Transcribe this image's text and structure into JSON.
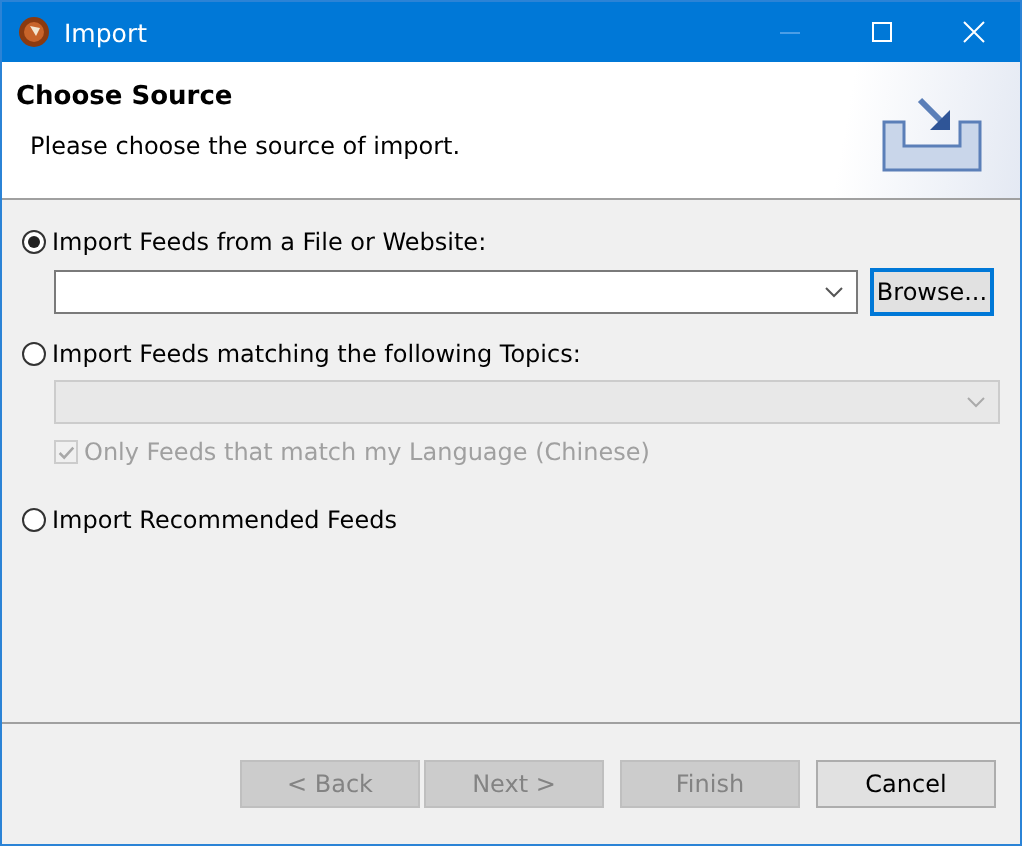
{
  "window": {
    "title": "Import"
  },
  "header": {
    "title": "Choose Source",
    "description": "Please choose the source of import."
  },
  "options": [
    {
      "kind": "file",
      "label": "Import Feeds from a File or Website:",
      "selected": true,
      "field": {
        "disabled": false
      },
      "button": "Browse..."
    },
    {
      "kind": "topics",
      "label": "Import Feeds matching the following Topics:",
      "selected": false,
      "field": {
        "disabled": true
      },
      "checkbox": {
        "label": "Only Feeds that match my Language (Chinese)",
        "checked": true,
        "disabled": true
      }
    },
    {
      "kind": "recommended",
      "label": "Import Recommended Feeds",
      "selected": false
    }
  ],
  "buttons": [
    {
      "label": "< Back",
      "disabled": true
    },
    {
      "label": "Next >",
      "disabled": true
    },
    {
      "label": "Finish",
      "disabled": true
    },
    {
      "label": "Cancel",
      "disabled": false
    }
  ]
}
